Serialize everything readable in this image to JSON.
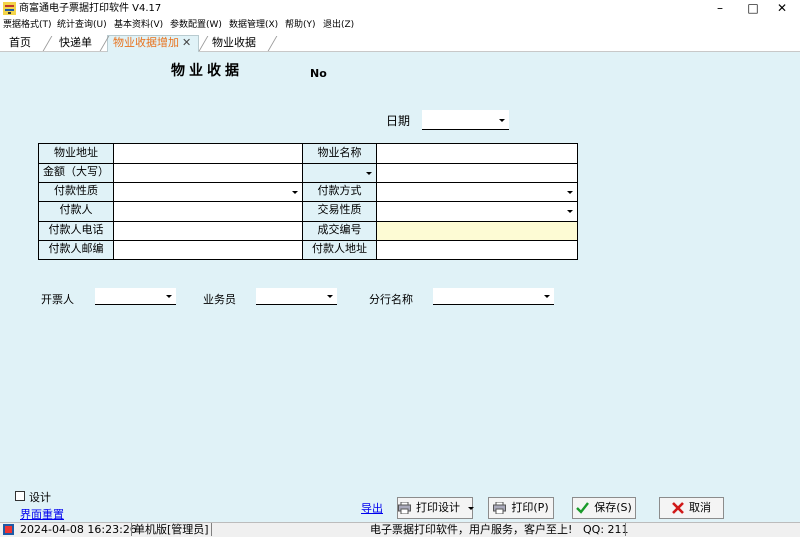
{
  "window": {
    "title": "商富通电子票据打印软件 V4.17",
    "minimize": "–",
    "maximize": "□",
    "close": "✕"
  },
  "menu": [
    {
      "label": "票据格式(T)"
    },
    {
      "label": "统计查询(U)"
    },
    {
      "label": "基本资料(V)"
    },
    {
      "label": "参数配置(W)"
    },
    {
      "label": "数据管理(X)"
    },
    {
      "label": "帮助(Y)"
    },
    {
      "label": "退出(Z)"
    }
  ],
  "tabs": [
    {
      "label": "首页",
      "active": false
    },
    {
      "label": "快递单",
      "active": false
    },
    {
      "label": "物业收据增加",
      "active": true,
      "close": "✕"
    },
    {
      "label": "物业收据",
      "active": false
    }
  ],
  "form": {
    "title": "物业收据",
    "no_label": "No",
    "date_label": "日期",
    "date_value": ""
  },
  "grid": {
    "left_labels": [
      "物业地址",
      "金额（大写）",
      "付款性质",
      "付款人",
      "付款人电话",
      "付款人邮编"
    ],
    "right_labels": [
      "物业名称",
      "",
      "付款方式",
      "交易性质",
      "成交编号",
      "付款人地址"
    ],
    "left_values": [
      "",
      "",
      "",
      "",
      "",
      ""
    ],
    "right_values": [
      "",
      "",
      "",
      "",
      "",
      ""
    ]
  },
  "lower": {
    "issuer_label": "开票人",
    "issuer_value": "",
    "salesman_label": "业务员",
    "salesman_value": "",
    "branch_label": "分行名称",
    "branch_value": ""
  },
  "bottom": {
    "design_label": "设计",
    "design_checked": false,
    "reset_label": "界面重置",
    "export_label": "导出",
    "print_design_label": "打印设计",
    "print_label": "打印(P)",
    "save_label": "保存(S)",
    "cancel_label": "取消"
  },
  "status": {
    "datetime": "2024-04-08 16:23:26",
    "mode": "单机版[管理员]",
    "message": "电子票据打印软件，用户服务，客户至上!",
    "qq": "QQ: 211"
  },
  "colors": {
    "workspace": "#e0f2f7",
    "highlight_field": "#fdfbd4",
    "active_tab_text": "#e8731e",
    "link": "#0000ee"
  }
}
